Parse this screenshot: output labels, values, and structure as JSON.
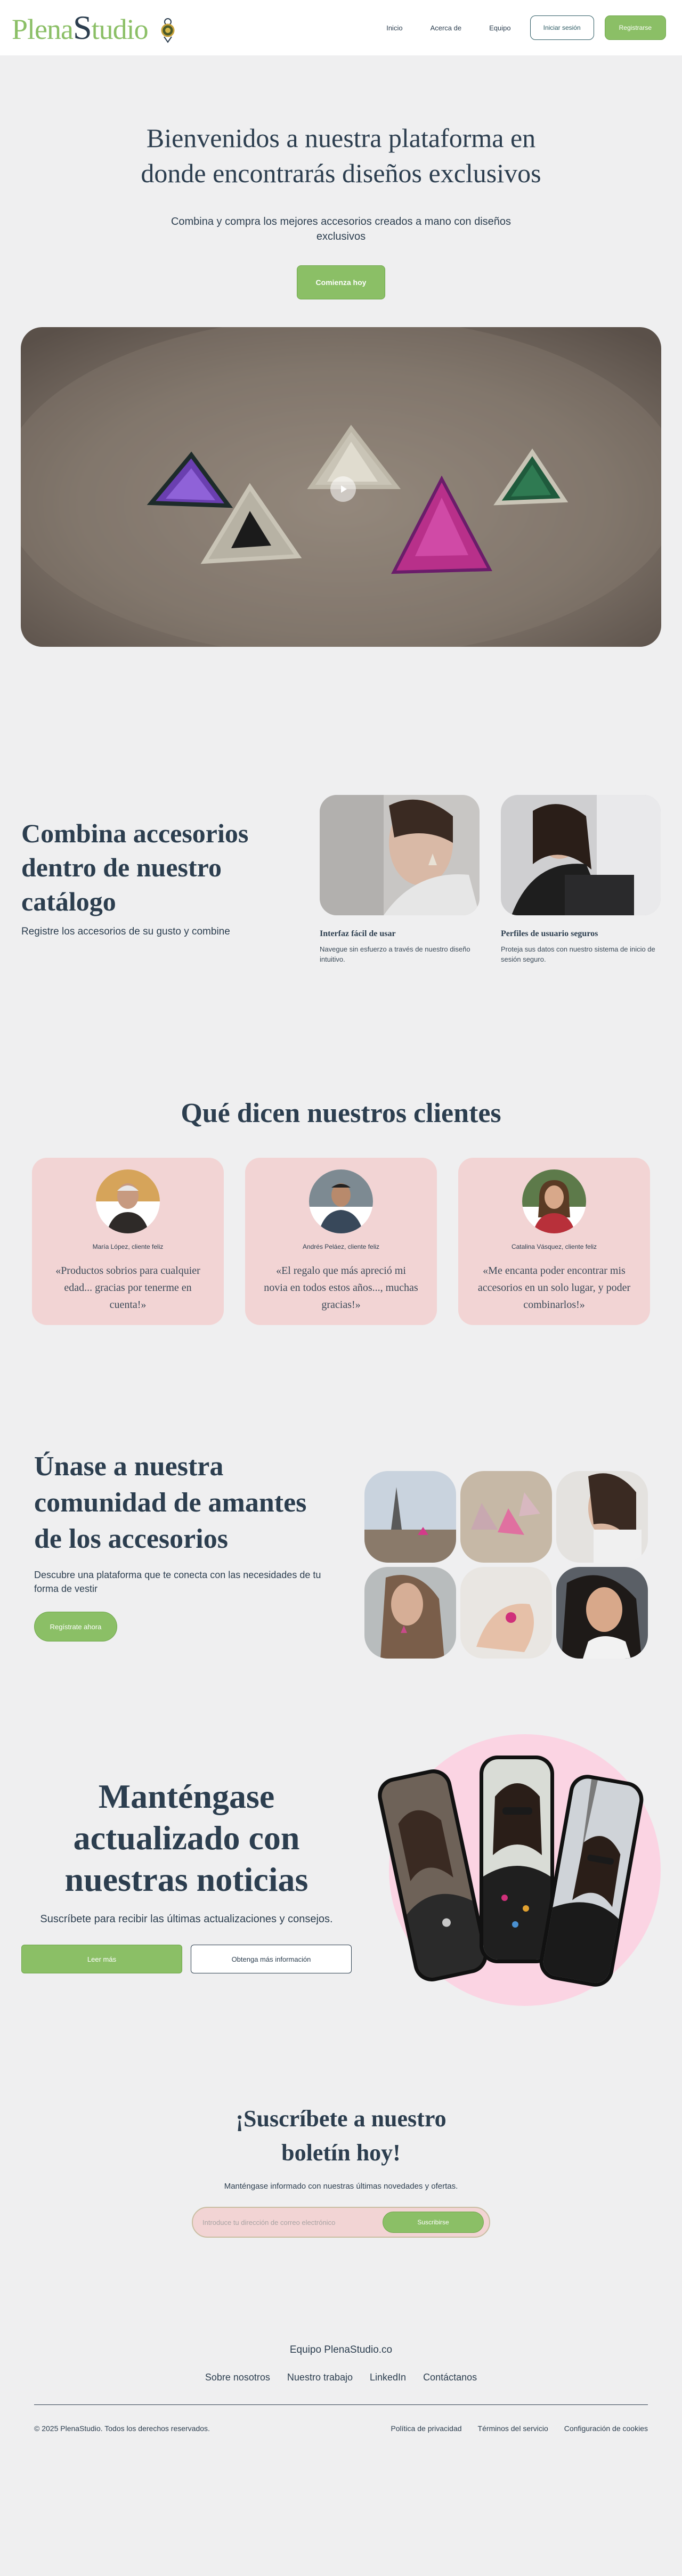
{
  "brand": {
    "logo_part1": "Plena",
    "logo_part2": "S",
    "logo_part3": "tudio"
  },
  "nav": {
    "links": [
      "Inicio",
      "Acerca de",
      "Equipo"
    ],
    "login": "Iniciar sesión",
    "register": "Registrarse"
  },
  "hero": {
    "title": "Bienvenidos a nuestra plataforma en donde encontrarás diseños exclusivos",
    "subtitle": "Combina y compra los mejores accesorios creados a mano con diseños exclusivos",
    "cta": "Comienza hoy"
  },
  "features": {
    "title": "Combina accesorios dentro de nuestro catálogo",
    "subtitle": "Registre los accesorios de su gusto y combine",
    "cards": [
      {
        "title": "Interfaz fácil de usar",
        "text": "Navegue sin esfuerzo a través de nuestro diseño intuitivo."
      },
      {
        "title": "Perfiles de usuario seguros",
        "text": "Proteja sus datos con nuestro sistema de inicio de sesión seguro."
      }
    ]
  },
  "testimonials": {
    "title": "Qué dicen nuestros clientes",
    "items": [
      {
        "name": "María López, cliente feliz",
        "quote": "«Productos sobrios para cualquier edad... gracias por tenerme en cuenta!»"
      },
      {
        "name": "Andrés Peláez, cliente feliz",
        "quote": "«El regalo que más apreció mi novia en todos estos años..., muchas gracias!»"
      },
      {
        "name": "Catalina Vásquez, cliente feliz",
        "quote": "«Me encanta poder encontrar mis accesorios en un solo lugar, y poder combinarlos!»"
      }
    ]
  },
  "community": {
    "title": "Únase a nuestra comunidad de amantes de los accesorios",
    "text": "Descubre una plataforma que te conecta con las necesidades de tu forma de vestir",
    "cta": "Regístrate ahora"
  },
  "news": {
    "title": "Manténgase actualizado con nuestras noticias",
    "subtitle": "Suscríbete para recibir las últimas actualizaciones y consejos.",
    "primary": "Leer más",
    "secondary": "Obtenga más información"
  },
  "newsletter": {
    "title": "¡Suscríbete a nuestro boletín hoy!",
    "text": "Manténgase informado con nuestras últimas novedades y ofertas.",
    "placeholder": "Introduce tu dirección de correo electrónico",
    "button": "Suscribirse"
  },
  "footer": {
    "brand": "Equipo PlenaStudio.co",
    "links": [
      "Sobre nosotros",
      "Nuestro trabajo",
      "LinkedIn",
      "Contáctanos"
    ],
    "copyright": "© 2025 PlenaStudio. Todos los derechos reservados.",
    "legal": [
      "Política de privacidad",
      "Términos del servicio",
      "Configuración de cookies"
    ]
  },
  "colors": {
    "accent": "#8bbf66",
    "text": "#2c3e4f",
    "card_pink": "#f2d4d4",
    "blob_pink": "#fbd4e3",
    "background": "#efeff0"
  }
}
